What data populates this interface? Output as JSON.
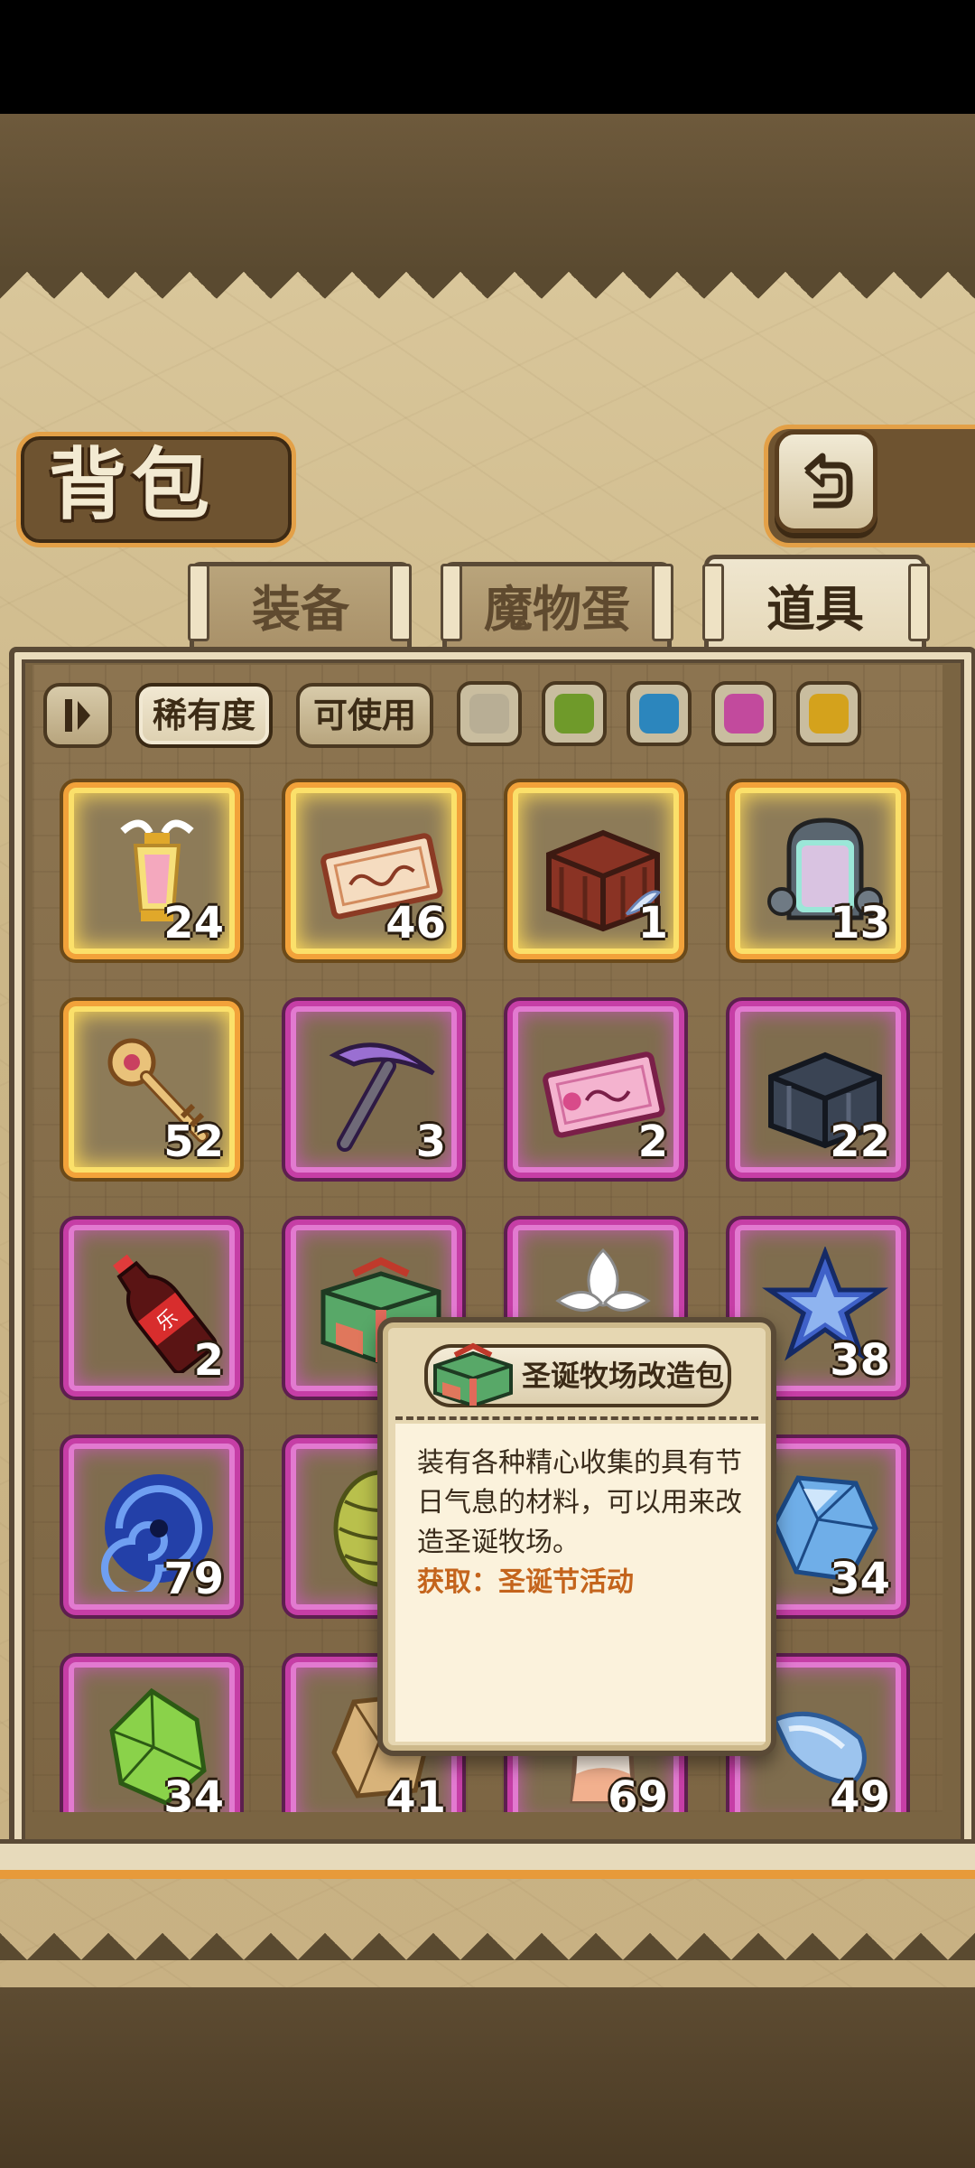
{
  "header": {
    "title": "背包"
  },
  "tabs": [
    {
      "label": "装备",
      "active": false
    },
    {
      "label": "魔物蛋",
      "active": false
    },
    {
      "label": "道具",
      "active": true
    }
  ],
  "filters": {
    "labels": [
      "稀有度",
      "可使用"
    ],
    "selected": "稀有度",
    "rarity_colors": [
      "#b8ae95",
      "#6f9a2a",
      "#2c86bd",
      "#c24a9d",
      "#d4a21c"
    ]
  },
  "items": [
    {
      "icon": "winged-lantern-icon",
      "count": "24",
      "rarity": "gold"
    },
    {
      "icon": "ticket-icon",
      "count": "46",
      "rarity": "gold"
    },
    {
      "icon": "wooden-crate-icon",
      "count": "1",
      "rarity": "gold"
    },
    {
      "icon": "rainbow-capsule-icon",
      "count": "13",
      "rarity": "gold"
    },
    {
      "icon": "golden-key-icon",
      "count": "52",
      "rarity": "gold"
    },
    {
      "icon": "pickaxe-icon",
      "count": "3",
      "rarity": "purple"
    },
    {
      "icon": "pink-ticket-icon",
      "count": "2",
      "rarity": "purple"
    },
    {
      "icon": "dark-crate-icon",
      "count": "22",
      "rarity": "purple"
    },
    {
      "icon": "cola-bottle-icon",
      "count": "2",
      "rarity": "purple"
    },
    {
      "icon": "gift-box-icon",
      "count": "",
      "rarity": "purple"
    },
    {
      "icon": "white-flower-icon",
      "count": "",
      "rarity": "purple"
    },
    {
      "icon": "blue-star-crystal-icon",
      "count": "38",
      "rarity": "purple"
    },
    {
      "icon": "blue-vortex-icon",
      "count": "79",
      "rarity": "purple"
    },
    {
      "icon": "green-cone-icon",
      "count": "",
      "rarity": "purple"
    },
    {
      "icon": "hidden-item-icon",
      "count": "",
      "rarity": "purple"
    },
    {
      "icon": "blue-gem-icon",
      "count": "34",
      "rarity": "purple"
    },
    {
      "icon": "green-gem-icon",
      "count": "34",
      "rarity": "purple"
    },
    {
      "icon": "tan-stone-icon",
      "count": "41",
      "rarity": "purple"
    },
    {
      "icon": "milk-bottle-icon",
      "count": "69",
      "rarity": "purple"
    },
    {
      "icon": "blue-shard-icon",
      "count": "49",
      "rarity": "purple"
    }
  ],
  "tooltip": {
    "title": "圣诞牧场改造包",
    "description": "装有各种精心收集的具有节日气息的材料，可以用来改造圣诞牧场。",
    "source": "获取：圣诞节活动"
  }
}
